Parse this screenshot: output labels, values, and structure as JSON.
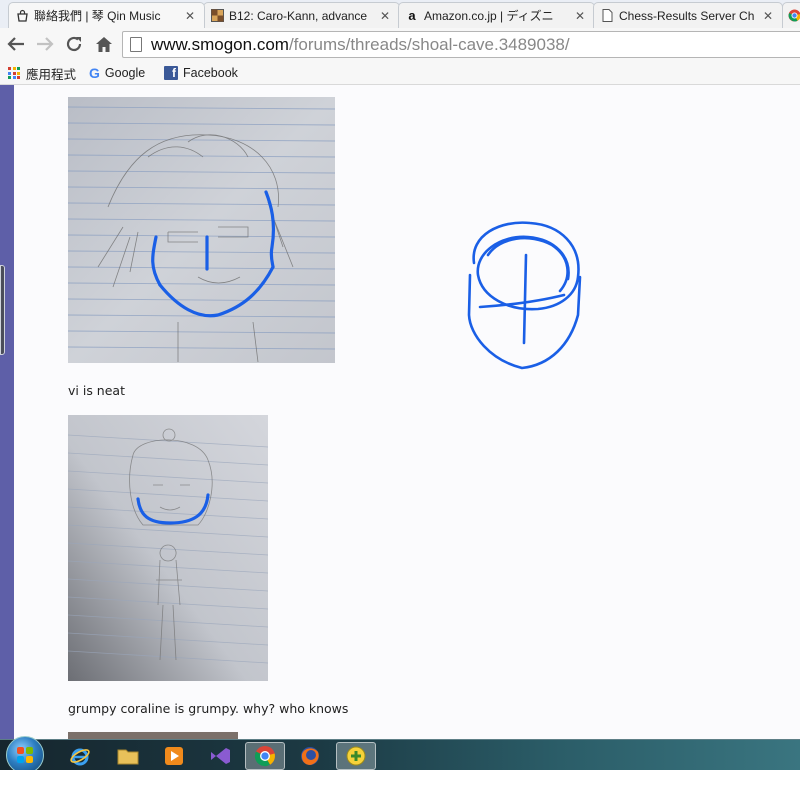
{
  "browser": {
    "tabs": [
      {
        "title": "聯絡我們 | 琴 Qin Music",
        "icon": "bag-icon",
        "active": true
      },
      {
        "title": "B12: Caro-Kann, advance",
        "icon": "chessboard-icon",
        "active": false
      },
      {
        "title": "Amazon.co.jp | ディズニ",
        "icon": "amazon-icon",
        "active": false
      },
      {
        "title": "Chess-Results Server Ch",
        "icon": "document-icon",
        "active": false
      },
      {
        "title": "",
        "icon": "chrome-icon",
        "active": false
      }
    ],
    "url": {
      "host": "www.smogon.com",
      "path": "/forums/threads/shoal-cave.3489038/"
    },
    "bookmarks": [
      {
        "label": "應用程式",
        "icon": "apps-grid-icon"
      },
      {
        "label": "Google",
        "icon": "google-icon"
      },
      {
        "label": "Facebook",
        "icon": "facebook-icon"
      }
    ]
  },
  "post": {
    "captions": [
      "vi is neat",
      "grumpy coraline is grumpy. why? who knows"
    ],
    "images": [
      {
        "subject": "vi sketch",
        "overlay_color": "#1a5fe6"
      },
      {
        "subject": "coraline sketch",
        "overlay_color": "#1a5fe6"
      }
    ]
  },
  "taskbar": {
    "icons": [
      "start-orb",
      "internet-explorer-icon",
      "file-explorer-icon",
      "media-player-icon",
      "visual-studio-icon",
      "chrome-icon",
      "firefox-icon",
      "app-plus-icon"
    ],
    "active": "chrome-icon"
  },
  "colors": {
    "forum_accent": "#5e5fa8",
    "doodle_blue": "#1a5fe6",
    "link_host": "#111111",
    "link_path": "#888888"
  }
}
